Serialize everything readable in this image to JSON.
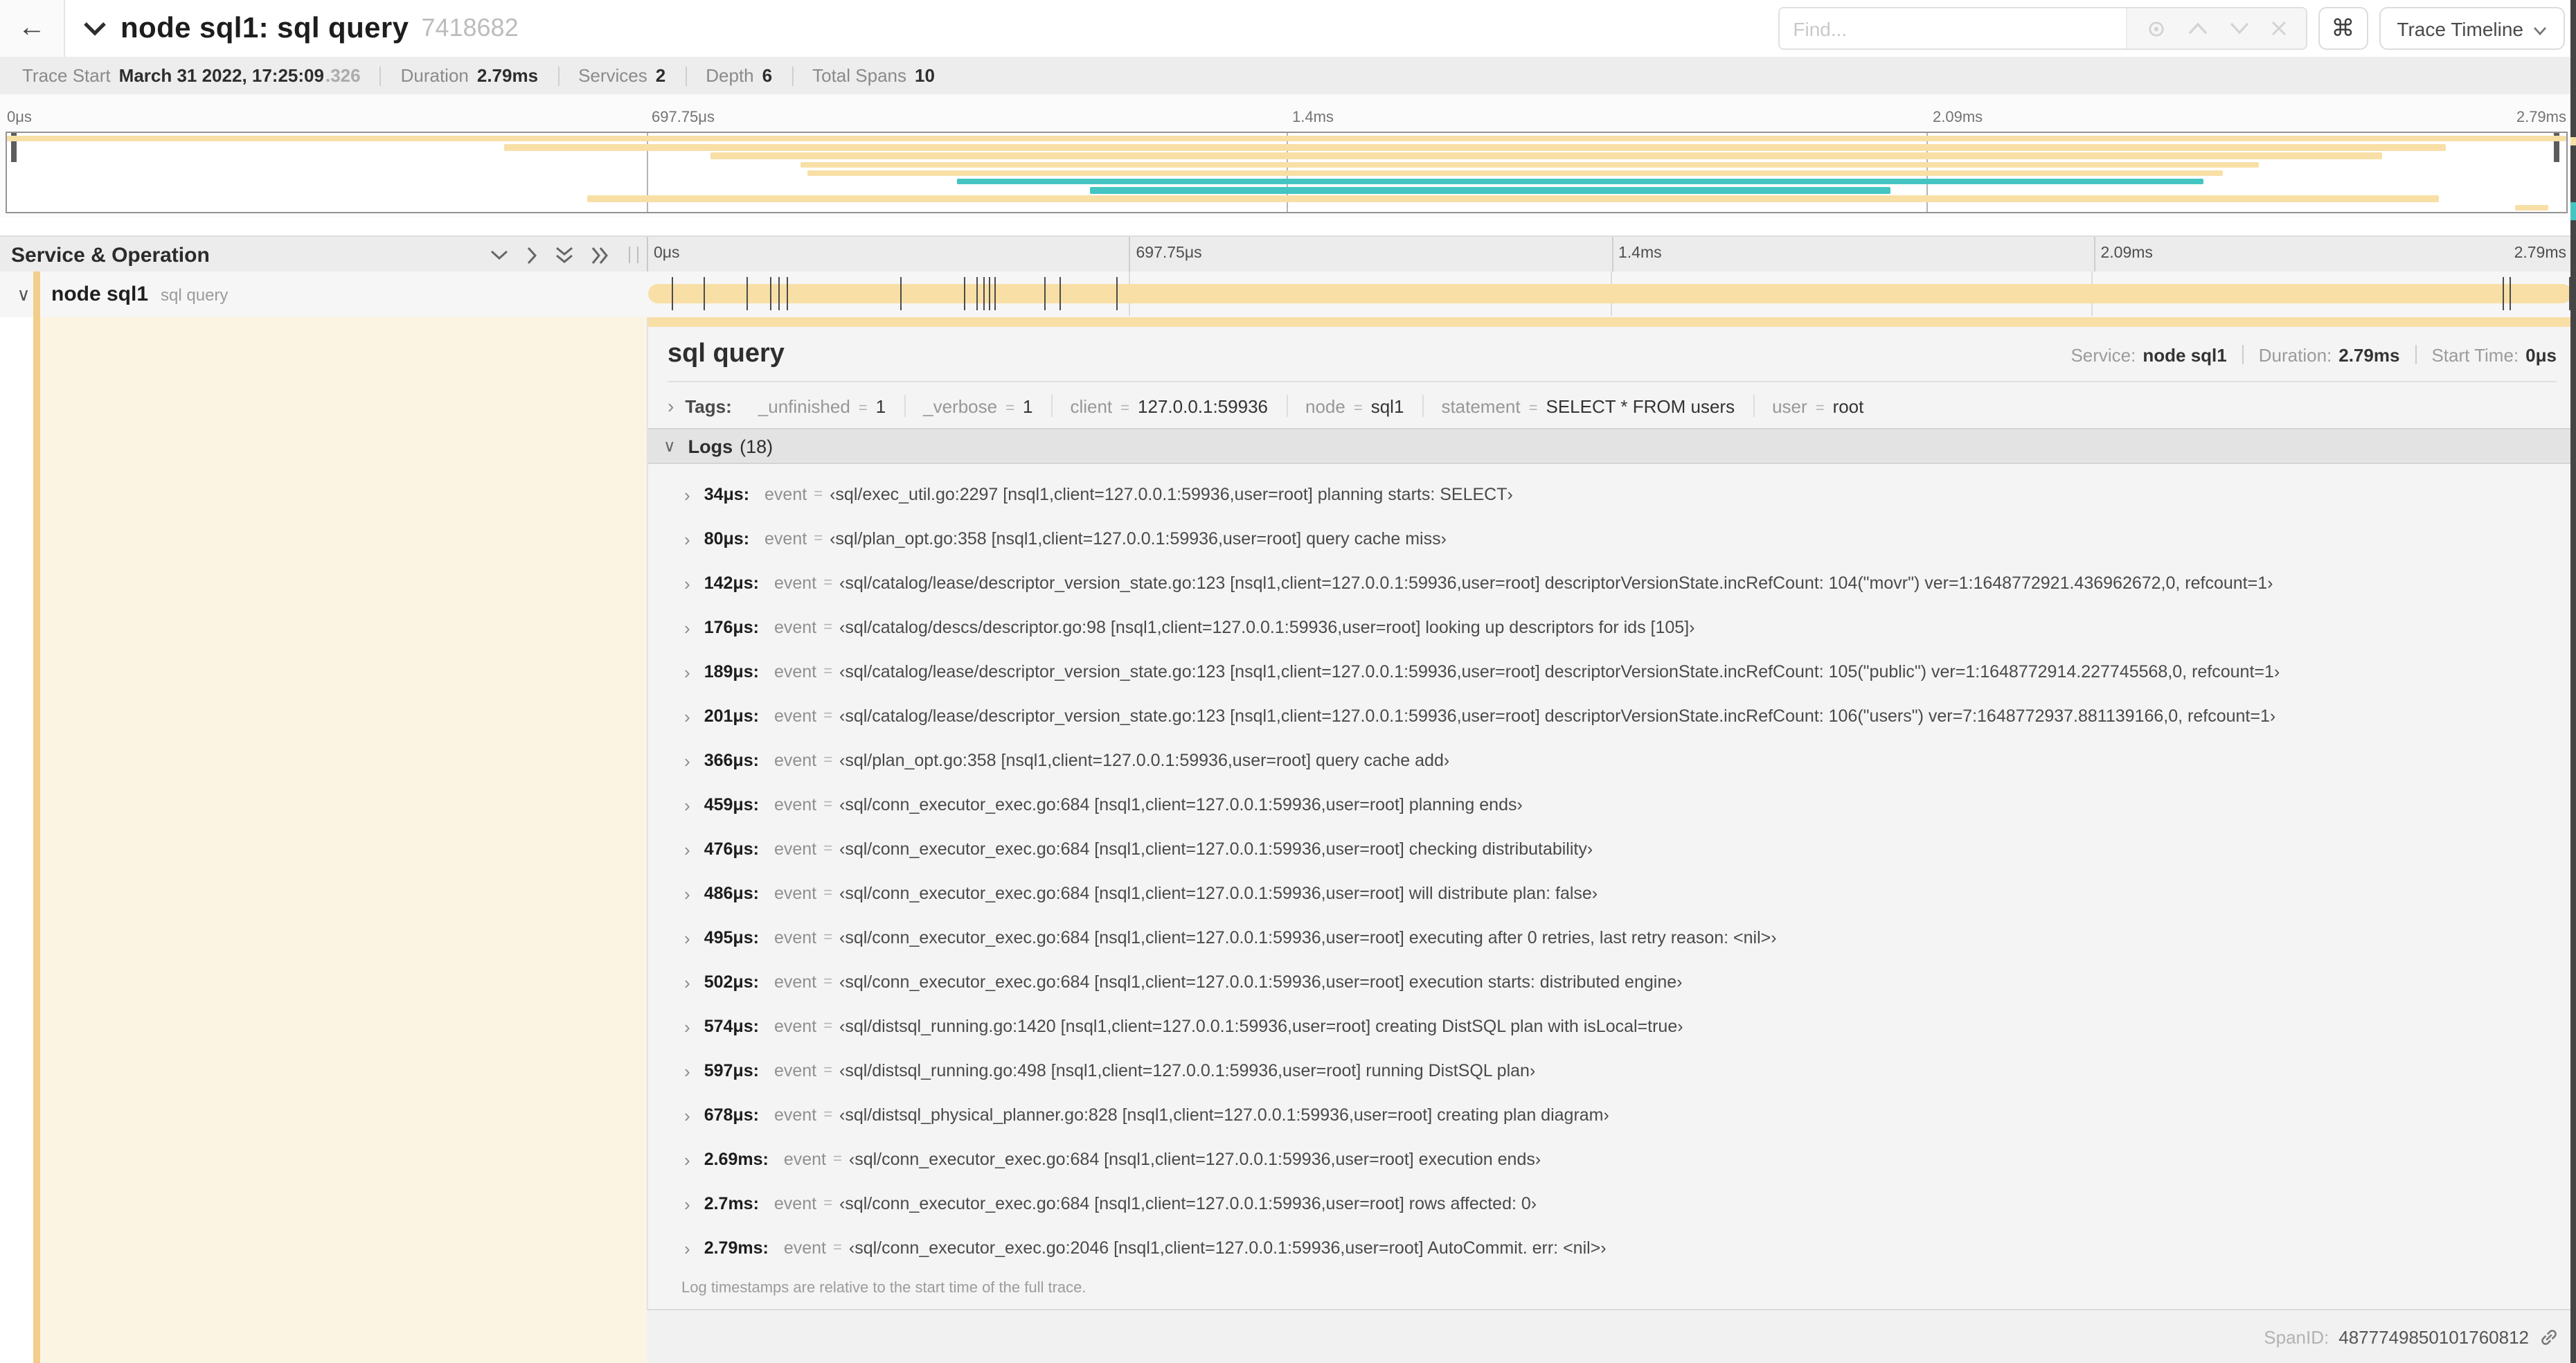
{
  "header": {
    "title": "node sql1: sql query",
    "trace_id": "7418682",
    "find_placeholder": "Find...",
    "shortcut_key": "⌘",
    "view_label": "Trace Timeline"
  },
  "summary": {
    "items": [
      {
        "label": "Trace Start",
        "value": "March 31 2022, 17:25:09",
        "suffix": ".326"
      },
      {
        "label": "Duration",
        "value": "2.79ms"
      },
      {
        "label": "Services",
        "value": "2"
      },
      {
        "label": "Depth",
        "value": "6"
      },
      {
        "label": "Total Spans",
        "value": "10"
      }
    ]
  },
  "minimap": {
    "axis_labels": [
      "0μs",
      "697.75μs",
      "1.4ms",
      "2.09ms",
      "2.79ms"
    ],
    "colors": {
      "tan": "#F8DFA6",
      "teal": "#44C5C2"
    },
    "bands": [
      {
        "start": 0,
        "end": 100,
        "color": "tan"
      },
      {
        "start": 19.4,
        "end": 95.3,
        "color": "tan"
      },
      {
        "start": 27.5,
        "end": 92.8,
        "color": "tan"
      },
      {
        "start": 31.0,
        "end": 88.0,
        "color": "tan"
      },
      {
        "start": 31.3,
        "end": 86.6,
        "color": "tan"
      },
      {
        "start": 37.1,
        "end": 85.8,
        "color": "teal"
      },
      {
        "start": 42.3,
        "end": 73.6,
        "color": "teal"
      },
      {
        "start": 22.7,
        "end": 95.0,
        "color": "tan"
      },
      {
        "start": 98.0,
        "end": 99.3,
        "color": "tan"
      }
    ]
  },
  "timeline_header": {
    "left_title": "Service & Operation",
    "ticks": [
      "0μs",
      "697.75μs",
      "1.4ms",
      "2.09ms",
      "2.79ms"
    ]
  },
  "span_row": {
    "service": "node sql1",
    "operation": "sql query",
    "tick_percents": [
      1.22,
      2.87,
      5.09,
      6.31,
      6.77,
      7.2,
      13.12,
      16.45,
      17.06,
      17.42,
      17.74,
      18.0,
      20.57,
      21.4,
      24.3,
      96.42,
      96.77,
      99.85
    ]
  },
  "detail": {
    "operation_title": "sql query",
    "service_label": "Service:",
    "service_value": "node sql1",
    "duration_label": "Duration:",
    "duration_value": "2.79ms",
    "start_label": "Start Time:",
    "start_value": "0μs",
    "tags_label": "Tags:",
    "tags": [
      {
        "key": "_unfinished",
        "value": "1"
      },
      {
        "key": "_verbose",
        "value": "1"
      },
      {
        "key": "client",
        "value": "127.0.0.1:59936"
      },
      {
        "key": "node",
        "value": "sql1"
      },
      {
        "key": "statement",
        "value": "SELECT * FROM users"
      },
      {
        "key": "user",
        "value": "root"
      }
    ],
    "logs_label": "Logs",
    "logs_count": "(18)",
    "logs": [
      {
        "time": "34μs:",
        "field": "event",
        "value": "‹sql/exec_util.go:2297 [nsql1,client=127.0.0.1:59936,user=root] planning starts: SELECT›"
      },
      {
        "time": "80μs:",
        "field": "event",
        "value": "‹sql/plan_opt.go:358 [nsql1,client=127.0.0.1:59936,user=root] query cache miss›"
      },
      {
        "time": "142μs:",
        "field": "event",
        "value": "‹sql/catalog/lease/descriptor_version_state.go:123 [nsql1,client=127.0.0.1:59936,user=root] descriptorVersionState.incRefCount: 104(\"movr\") ver=1:1648772921.436962672,0, refcount=1›"
      },
      {
        "time": "176μs:",
        "field": "event",
        "value": "‹sql/catalog/descs/descriptor.go:98 [nsql1,client=127.0.0.1:59936,user=root] looking up descriptors for ids [105]›"
      },
      {
        "time": "189μs:",
        "field": "event",
        "value": "‹sql/catalog/lease/descriptor_version_state.go:123 [nsql1,client=127.0.0.1:59936,user=root] descriptorVersionState.incRefCount: 105(\"public\") ver=1:1648772914.227745568,0, refcount=1›"
      },
      {
        "time": "201μs:",
        "field": "event",
        "value": "‹sql/catalog/lease/descriptor_version_state.go:123 [nsql1,client=127.0.0.1:59936,user=root] descriptorVersionState.incRefCount: 106(\"users\") ver=7:1648772937.881139166,0, refcount=1›"
      },
      {
        "time": "366μs:",
        "field": "event",
        "value": "‹sql/plan_opt.go:358 [nsql1,client=127.0.0.1:59936,user=root] query cache add›"
      },
      {
        "time": "459μs:",
        "field": "event",
        "value": "‹sql/conn_executor_exec.go:684 [nsql1,client=127.0.0.1:59936,user=root] planning ends›"
      },
      {
        "time": "476μs:",
        "field": "event",
        "value": "‹sql/conn_executor_exec.go:684 [nsql1,client=127.0.0.1:59936,user=root] checking distributability›"
      },
      {
        "time": "486μs:",
        "field": "event",
        "value": "‹sql/conn_executor_exec.go:684 [nsql1,client=127.0.0.1:59936,user=root] will distribute plan: false›"
      },
      {
        "time": "495μs:",
        "field": "event",
        "value": "‹sql/conn_executor_exec.go:684 [nsql1,client=127.0.0.1:59936,user=root] executing after 0 retries, last retry reason: <nil>›"
      },
      {
        "time": "502μs:",
        "field": "event",
        "value": "‹sql/conn_executor_exec.go:684 [nsql1,client=127.0.0.1:59936,user=root] execution starts: distributed engine›"
      },
      {
        "time": "574μs:",
        "field": "event",
        "value": "‹sql/distsql_running.go:1420 [nsql1,client=127.0.0.1:59936,user=root] creating DistSQL plan with isLocal=true›"
      },
      {
        "time": "597μs:",
        "field": "event",
        "value": "‹sql/distsql_running.go:498 [nsql1,client=127.0.0.1:59936,user=root] running DistSQL plan›"
      },
      {
        "time": "678μs:",
        "field": "event",
        "value": "‹sql/distsql_physical_planner.go:828 [nsql1,client=127.0.0.1:59936,user=root] creating plan diagram›"
      },
      {
        "time": "2.69ms:",
        "field": "event",
        "value": "‹sql/conn_executor_exec.go:684 [nsql1,client=127.0.0.1:59936,user=root] execution ends›"
      },
      {
        "time": "2.7ms:",
        "field": "event",
        "value": "‹sql/conn_executor_exec.go:684 [nsql1,client=127.0.0.1:59936,user=root] rows affected: 0›"
      },
      {
        "time": "2.79ms:",
        "field": "event",
        "value": "‹sql/conn_executor_exec.go:2046 [nsql1,client=127.0.0.1:59936,user=root] AutoCommit. err: <nil>›"
      }
    ],
    "footnote": "Log timestamps are relative to the start time of the full trace.",
    "spanid_label": "SpanID:",
    "spanid_value": "4877749850101760812"
  }
}
